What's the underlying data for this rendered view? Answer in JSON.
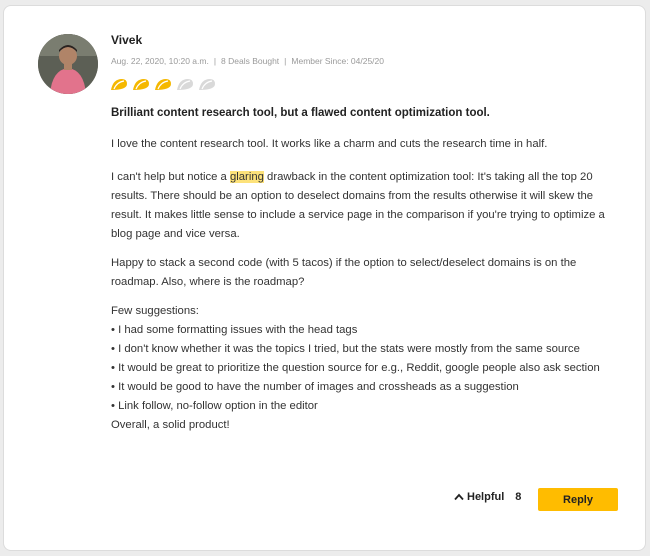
{
  "review": {
    "author": "Vivek",
    "date": "Aug. 22, 2020, 10:20 a.m.",
    "deals": "8 Deals Bought",
    "member_since": "Member Since: 04/25/20",
    "separator": "|",
    "rating": 3,
    "rating_max": 5,
    "title": "Brilliant content research tool, but a flawed content optimization tool.",
    "p1": "I love the content research tool. It works like a charm and cuts the research time in half.",
    "p2_before": "I can't help but notice a ",
    "p2_highlight": "glaring",
    "p2_after": " drawback in the content optimization tool: It's taking all the top 20 results. There should be an option to deselect domains from the results otherwise it will skew the result. It makes little sense to include a service page in the comparison if you're trying to optimize a blog page and vice versa.",
    "p3": "Happy to stack a second code (with 5 tacos) if the option to select/deselect domains is on the roadmap. Also, where is the roadmap?",
    "p4_intro": "Few suggestions:",
    "suggestions": [
      "• I had some formatting issues with the head tags",
      "• I don't know whether it was the topics I tried, but the stats were mostly from the same source",
      "• It would be great to prioritize the question source for e.g., Reddit, google people also ask section",
      "• It would be good to have the number of images and crossheads as a suggestion",
      "• Link follow, no-follow option in the editor"
    ],
    "closing": "Overall, a solid product!"
  },
  "actions": {
    "helpful_label": "Helpful",
    "helpful_count": "8",
    "reply_label": "Reply"
  },
  "colors": {
    "accent": "#ffbc00",
    "taco_filled": "#f5b800",
    "taco_empty": "#d9d9d9",
    "highlight": "#fde27a"
  }
}
